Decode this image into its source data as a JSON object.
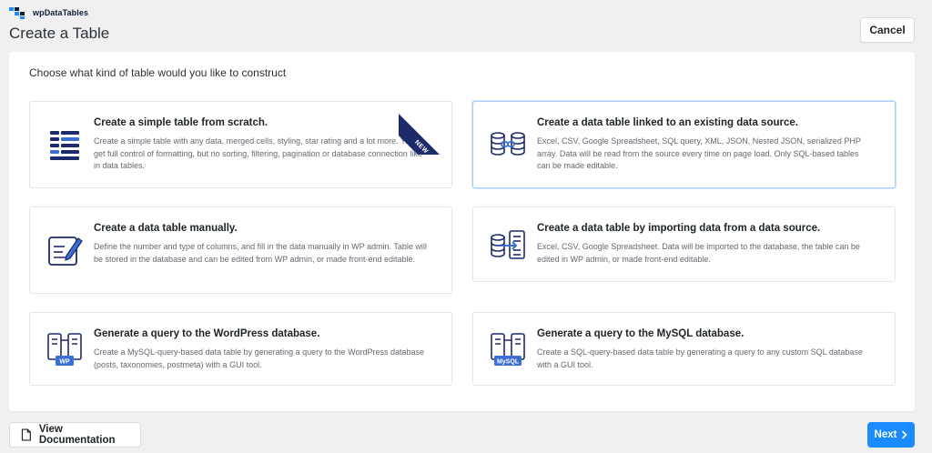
{
  "app": {
    "logo_text": "wpDataTables",
    "page_title": "Create a Table"
  },
  "header": {
    "cancel_label": "Cancel"
  },
  "panel": {
    "prompt": "Choose what kind of table would you like to construct"
  },
  "options": [
    {
      "icon": "simple-table-icon",
      "title": "Create a simple table from scratch.",
      "description": "Create a simple table with any data, merged cells, styling, star rating and a lot more. You get full control of formatting, but no sorting, filtering, pagination or database connection like in data tables.",
      "badge": "NEW",
      "selected": false
    },
    {
      "icon": "linked-data-source-icon",
      "title": "Create a data table linked to an existing data source.",
      "description": "Excel, CSV, Google Spreadsheet, SQL query, XML, JSON, Nested JSON, serialized PHP array. Data will be read from the source every time on page load. Only SQL-based tables can be made editable.",
      "selected": true
    },
    {
      "icon": "manual-entry-icon",
      "title": "Create a data table manually.",
      "description": "Define the number and type of columns, and fill in the data manually in WP admin. Table will be stored in the database and can be edited from WP admin, or made front-end editable.",
      "selected": false
    },
    {
      "icon": "import-data-icon",
      "title": "Create a data table by importing data from a data source.",
      "description": "Excel, CSV, Google Spreadsheet. Data will be imported to the database, the table can be edited in WP admin, or made front-end editable.",
      "selected": false
    },
    {
      "icon": "wordpress-query-icon",
      "title": "Generate a query to the WordPress database.",
      "description": "Create a MySQL-query-based data table by generating a query to the WordPress database (posts, taxonomies, postmeta) with a GUI tool.",
      "icon_label": "WP",
      "selected": false
    },
    {
      "icon": "mysql-query-icon",
      "title": "Generate a query to the MySQL database.",
      "description": "Create a SQL-query-based data table by generating a query to any custom SQL database with a GUI tool.",
      "icon_label": "MySQL",
      "selected": false
    }
  ],
  "footer": {
    "docs_label": "View Documentation",
    "next_label": "Next"
  },
  "colors": {
    "primary": "#1a8cff",
    "navy": "#1e2b6b",
    "icon_blue": "#3b6fd6"
  }
}
